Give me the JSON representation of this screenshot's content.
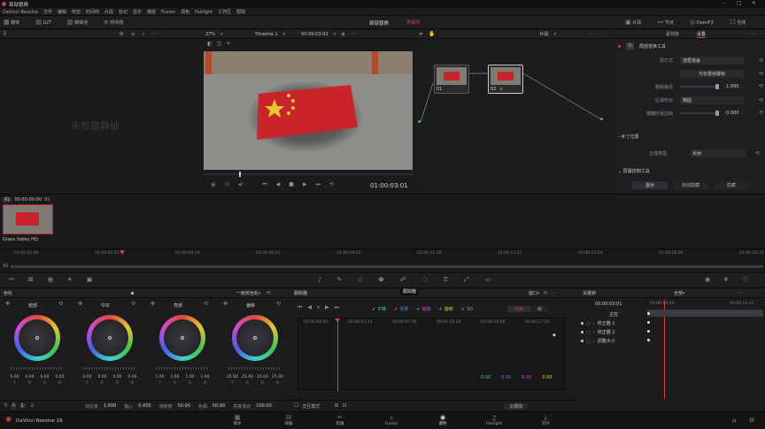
{
  "app": {
    "title": "局部替换",
    "logo_text": "DaVinci Resolve 16"
  },
  "menu": [
    "DaVinci Resolve",
    "文件",
    "编辑",
    "修剪",
    "时间线",
    "片段",
    "标记",
    "显示",
    "播放",
    "Fusion",
    "调色",
    "Fairlight",
    "工作区",
    "帮助"
  ],
  "toolbar": {
    "left": [
      "媒体",
      "LUT",
      "媒体池",
      "时间线"
    ],
    "center_title": "局部替换",
    "center_status": "未保存",
    "right": [
      "片段",
      "节点",
      "OpenFX",
      "光线"
    ]
  },
  "viewer": {
    "zoom": "27%",
    "timeline": "Timeline 1",
    "timecode_top": "00:00:03:01",
    "clip_mode": "片段",
    "timecode": "01:00:03:01",
    "watermark": "未剪建静帧"
  },
  "nodes": [
    {
      "id": "01",
      "label": "01"
    },
    {
      "id": "02",
      "label": "02"
    }
  ],
  "inspector": {
    "tabs": [
      "素材库",
      "设置"
    ],
    "fx_title": "局部替换工具",
    "rows": [
      {
        "label": "源方式",
        "value": "选框遮盖",
        "type": "select"
      },
      {
        "label": "",
        "value": "光标重绘键帧",
        "type": "button"
      },
      {
        "label": "删除路径",
        "value": "1.000",
        "type": "slider"
      },
      {
        "label": "区域形状",
        "value": "椭圆",
        "type": "select"
      },
      {
        "label": "模糊形状边缘",
        "value": "0.000",
        "type": "slider"
      }
    ],
    "section2": "补丁位置",
    "row2": {
      "label": "合成类型",
      "value": "反射"
    },
    "section3": "屏幕控制工具",
    "buttons": [
      "显示",
      "自动隐藏",
      "隐藏"
    ]
  },
  "gallery": {
    "tc": "00:00:00:00",
    "track": "V1",
    "clip_name": "Grass Valley HQ",
    "clip_index": "01"
  },
  "ruler": [
    "01:00:00:00",
    "01:00:02:01",
    "01:00:04:14",
    "01:00:06:21",
    "01:00:09:03",
    "01:00:11:10",
    "01:00:13:17",
    "01:00:15:24",
    "01:00:18:06",
    "01:00:20:13"
  ],
  "track_label": "V1",
  "color_panel": {
    "title": "色轮",
    "mode": "一级校色轮",
    "wheels": [
      {
        "name": "暗部",
        "values": [
          "0.00",
          "0.00",
          "0.00",
          "0.00"
        ]
      },
      {
        "name": "中灰",
        "values": [
          "0.00",
          "0.00",
          "0.00",
          "0.00"
        ]
      },
      {
        "name": "亮部",
        "values": [
          "1.00",
          "1.00",
          "1.00",
          "1.00"
        ]
      },
      {
        "name": "偏移",
        "values": [
          "25.00",
          "25.00",
          "25.00",
          "25.00"
        ]
      }
    ],
    "channels": [
      "Y",
      "R",
      "G",
      "B"
    ],
    "footer": [
      {
        "label": "对比度",
        "value": "1.000"
      },
      {
        "label": "轴心",
        "value": "0.435"
      },
      {
        "label": "饱和度",
        "value": "50.00"
      },
      {
        "label": "色相",
        "value": "50.00"
      },
      {
        "label": "亮度混合",
        "value": "100.00"
      }
    ],
    "pages": [
      "1",
      "2"
    ]
  },
  "tracker": {
    "title": "跟踪器",
    "window": "窗口",
    "tooltip": "跟踪器",
    "checks": [
      {
        "label": "平移",
        "color": "#3ec2c2"
      },
      {
        "label": "竖移",
        "color": "#4b7be0"
      },
      {
        "label": "缩放",
        "color": "#d14bd1"
      },
      {
        "label": "旋转",
        "color": "#e6d23a"
      },
      {
        "label": "3D",
        "color": "#5b9ee6"
      }
    ],
    "modes": [
      "片段",
      "帧"
    ],
    "ticks": [
      "00:00:00:00",
      "00:00:03:15",
      "00:00:07:06",
      "00:00:10:19",
      "00:00:14:08",
      "00:00:17:22"
    ],
    "values": [
      {
        "v": "0.00",
        "color": "#3ec2c2"
      },
      {
        "v": "0.00",
        "color": "#4b7be0"
      },
      {
        "v": "0.00",
        "color": "#d14bd1"
      },
      {
        "v": "0.00",
        "color": "#e6d23a"
      }
    ],
    "footer_left": "交互模式",
    "footer_right": "云跟踪"
  },
  "keyframes": {
    "title": "关键帧",
    "scope": "全部",
    "tc": "00:00:03:01",
    "tc2": "01:00:00:00",
    "tc3": "00:00:14:11",
    "rows": [
      "主控",
      "校正器 1",
      "校正器 2",
      "调整大小"
    ]
  },
  "pages": [
    "媒体",
    "快编",
    "剪辑",
    "Fusion",
    "调色",
    "Fairlight",
    "交付"
  ],
  "active_page": "调色"
}
